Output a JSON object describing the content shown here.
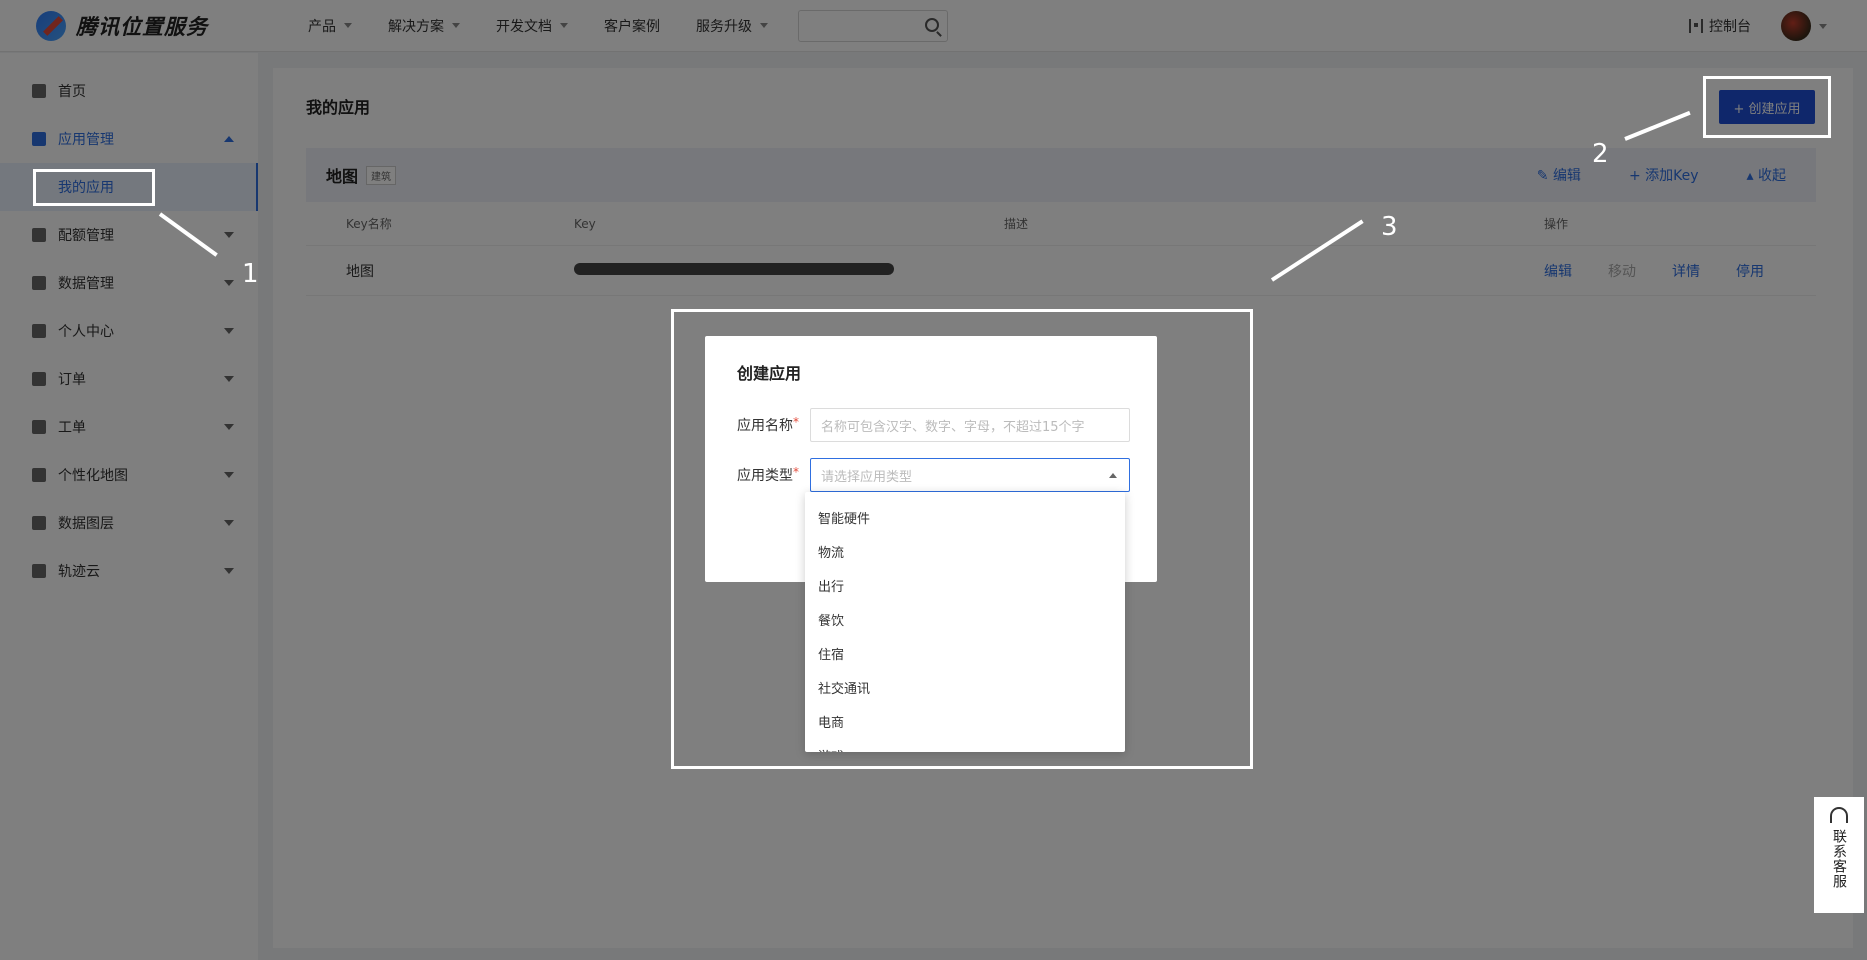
{
  "header": {
    "logo_text": "腾讯位置服务",
    "nav": [
      {
        "label": "产品",
        "has_caret": true
      },
      {
        "label": "解决方案",
        "has_caret": true
      },
      {
        "label": "开发文档",
        "has_caret": true
      },
      {
        "label": "客户案例",
        "has_caret": false
      },
      {
        "label": "服务升级",
        "has_caret": true
      }
    ],
    "console_label": "控制台"
  },
  "sidebar": {
    "items": [
      {
        "label": "首页"
      },
      {
        "label": "应用管理"
      },
      {
        "label": "我的应用"
      },
      {
        "label": "配额管理"
      },
      {
        "label": "数据管理"
      },
      {
        "label": "个人中心"
      },
      {
        "label": "订单"
      },
      {
        "label": "工单"
      },
      {
        "label": "个性化地图"
      },
      {
        "label": "数据图层"
      },
      {
        "label": "轨迹云"
      }
    ]
  },
  "main": {
    "title": "我的应用",
    "create_button": "+ 创建应用",
    "app": {
      "name": "地图",
      "tag": "建筑",
      "actions": [
        "编辑",
        "添加Key",
        "收起"
      ],
      "columns": [
        "Key名称",
        "Key",
        "描述",
        "操作"
      ],
      "row": {
        "key_name": "地图",
        "description": "",
        "ops": [
          "编辑",
          "移动",
          "详情",
          "停用"
        ]
      }
    }
  },
  "modal": {
    "title": "创建应用",
    "name_label": "应用名称",
    "name_placeholder": "名称可包含汉字、数字、字母，不超过15个字",
    "type_label": "应用类型",
    "type_placeholder": "请选择应用类型",
    "type_options": [
      "智能硬件",
      "物流",
      "出行",
      "餐饮",
      "住宿",
      "社交通讯",
      "电商",
      "游戏"
    ]
  },
  "annotations": {
    "labels": [
      "1",
      "2",
      "3"
    ]
  },
  "customer_service": {
    "label": "联系客服"
  }
}
